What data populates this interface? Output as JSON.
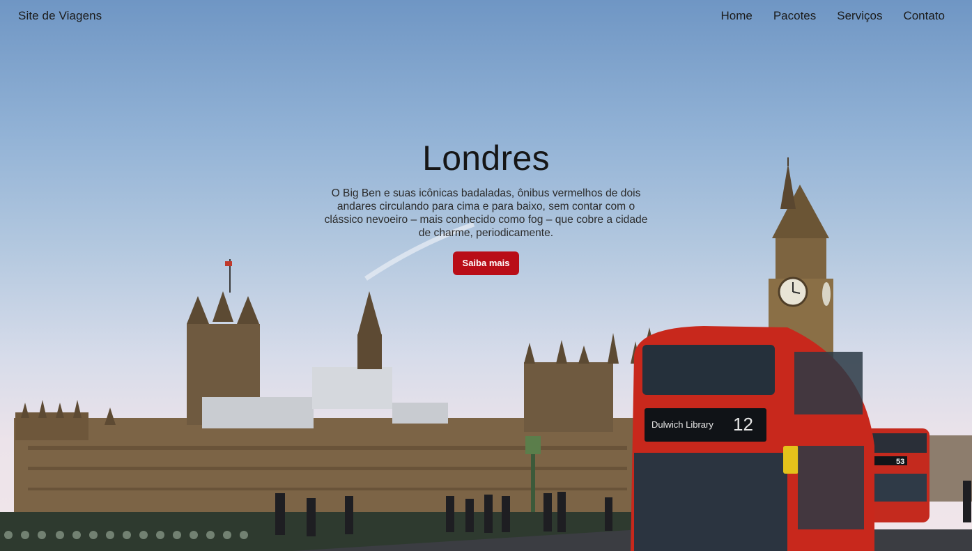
{
  "navbar": {
    "brand": "Site de Viagens",
    "links": [
      {
        "label": "Home"
      },
      {
        "label": "Pacotes"
      },
      {
        "label": "Serviços"
      },
      {
        "label": "Contato"
      }
    ]
  },
  "hero": {
    "title": "Londres",
    "description": "O Big Ben e suas icônicas badaladas, ônibus vermelhos de dois andares circulando para cima e para baixo, sem contar com o clássico nevoeiro – mais conhecido como fog – que cobre a cidade de charme, periodicamente.",
    "cta_label": "Saiba mais",
    "bus_sign_front": "Dulwich Library",
    "bus_number_front": "12",
    "bus_number_back": "53"
  },
  "colors": {
    "accent_button": "#b90d17",
    "text": "#1b1b1b",
    "bus_red": "#c8281c"
  }
}
